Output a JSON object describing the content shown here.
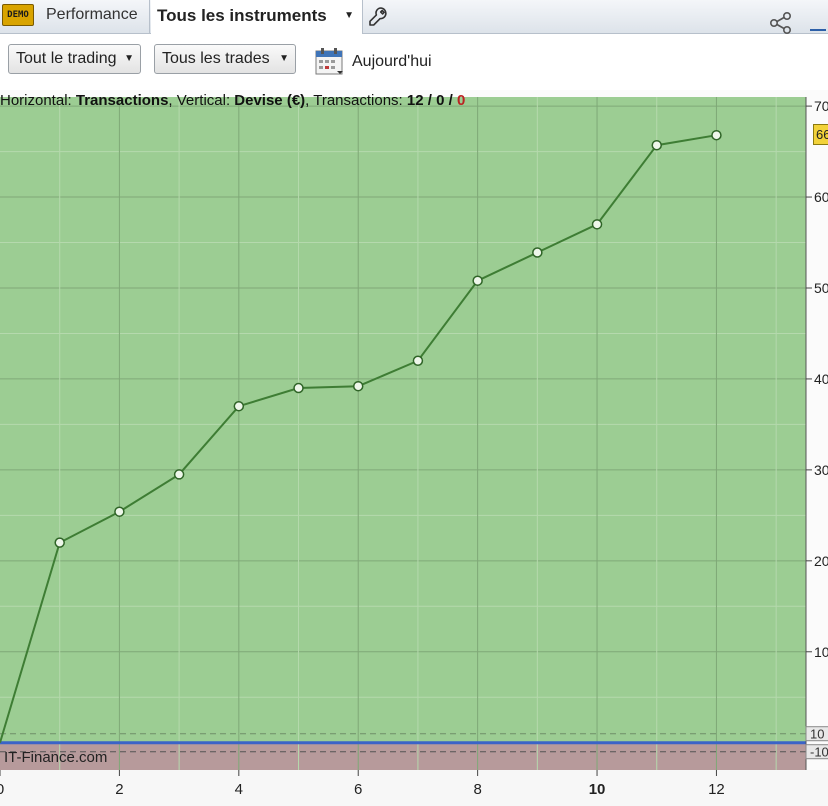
{
  "toolbar": {
    "demo_badge": "DEMO",
    "tab_performance": "Performance",
    "tab_instruments": "Tous les instruments",
    "wrench_icon": "wrench-icon",
    "share_icon": "share-icon"
  },
  "filters": {
    "trading_label": "Tout le trading",
    "trades_label": "Tous les trades",
    "date_label": "Aujourd'hui",
    "calendar_icon": "calendar-icon"
  },
  "chart_info": {
    "prefix": "Horizontal: ",
    "horizontal": "Transactions",
    "mid": ", Vertical: ",
    "vertical": "Devise (€)",
    "suffix": ", Transactions: ",
    "count_win": "12",
    "sep1": " / ",
    "count_zero": "0",
    "sep2": " / ",
    "count_loss": "0"
  },
  "watermark": "IT-Finance.com",
  "last_value_label": "66",
  "colors": {
    "profit_area": "#9ccd93",
    "loss_area": "#b79a9b",
    "line": "#3e7d34",
    "accent_badge": "#f2d23a",
    "zero_line": "#3b63c7"
  },
  "chart_data": {
    "type": "line",
    "xlabel": "Transactions",
    "ylabel": "Devise (€)",
    "x": [
      0,
      1,
      2,
      3,
      4,
      5,
      6,
      7,
      8,
      9,
      10,
      11,
      12
    ],
    "values": [
      0,
      22,
      25.4,
      29.5,
      37,
      39,
      39.2,
      42,
      50.8,
      53.9,
      57,
      65.7,
      66.8
    ],
    "xlim": [
      0,
      13.5
    ],
    "ylim": [
      -3,
      71
    ],
    "x_ticks": [
      0,
      2,
      4,
      6,
      8,
      10,
      12
    ],
    "x_tick_labels": [
      "0",
      "2",
      "4",
      "6",
      "8",
      "10",
      "12"
    ],
    "y_ticks": [
      70,
      60,
      50,
      40,
      30,
      20,
      10
    ],
    "y_tick_labels": [
      "70",
      "60",
      "50",
      "40",
      "30",
      "20",
      "10"
    ],
    "threshold_labels": [
      "10",
      "-10"
    ],
    "grid": true,
    "legend": "none"
  }
}
